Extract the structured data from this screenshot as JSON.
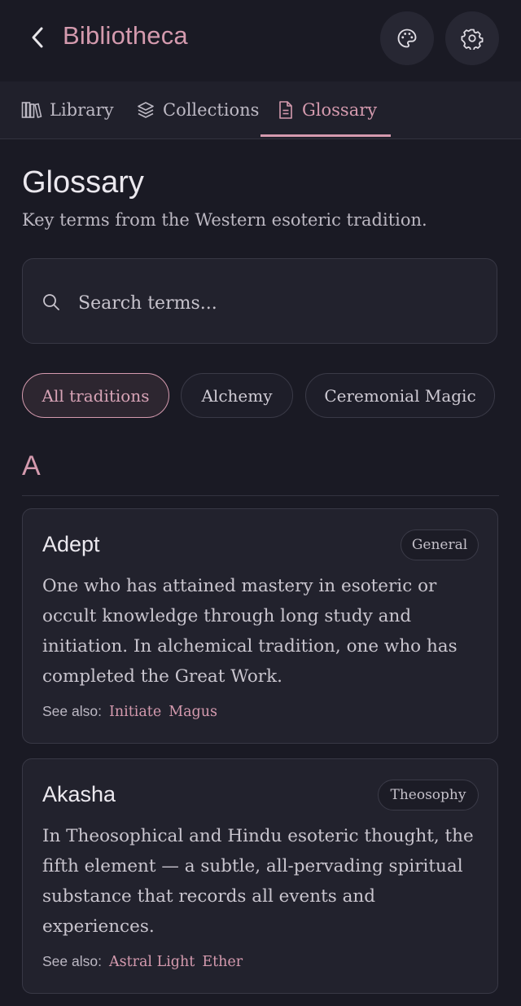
{
  "header": {
    "title": "Bibliotheca",
    "back_icon": "chevron-left-icon",
    "theme_icon": "palette-icon",
    "settings_icon": "gear-icon"
  },
  "tabs": [
    {
      "label": "Library",
      "icon": "books-icon",
      "active": false
    },
    {
      "label": "Collections",
      "icon": "layers-icon",
      "active": false
    },
    {
      "label": "Glossary",
      "icon": "document-icon",
      "active": true
    }
  ],
  "main": {
    "title": "Glossary",
    "subtitle": "Key terms from the Western esoteric tradition.",
    "search": {
      "placeholder": "Search terms...",
      "value": ""
    },
    "filters": [
      "All traditions",
      "Alchemy",
      "Ceremonial Magic"
    ],
    "active_filter": "All traditions",
    "section_letter": "A",
    "entries": [
      {
        "term": "Adept",
        "tradition": "General",
        "definition": "One who has attained mastery in esoteric or occult knowledge through long study and initiation. In alchemical tradition, one who has completed the Great Work.",
        "see_also_label": "See also:",
        "see_also": [
          "Initiate",
          "Magus"
        ]
      },
      {
        "term": "Akasha",
        "tradition": "Theosophy",
        "definition": "In Theosophical and Hindu esoteric thought, the fifth element — a subtle, all-pervading spiritual substance that records all events and experiences.",
        "see_also_label": "See also:",
        "see_also": [
          "Astral Light",
          "Ether"
        ]
      }
    ]
  },
  "colors": {
    "accent": "#d49aae",
    "background": "#1a1a24",
    "card": "#22222d"
  }
}
